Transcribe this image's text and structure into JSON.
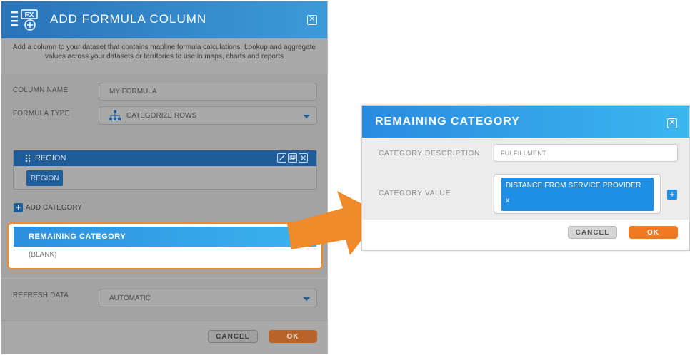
{
  "left_dialog": {
    "title": "ADD FORMULA COLUMN",
    "logo_label": "FX",
    "description": "Add a column to your dataset that contains mapline formula calculations. Lookup and aggregate values across your datasets or territories to use in maps, charts and reports",
    "column_name": {
      "label": "COLUMN NAME",
      "value": "MY FORMULA"
    },
    "formula_type": {
      "label": "FORMULA TYPE",
      "value": "CATEGORIZE ROWS"
    },
    "region": {
      "title": "REGION",
      "chip": "REGION"
    },
    "add_category": "ADD CATEGORY",
    "remaining_category": {
      "title": "REMAINING CATEGORY",
      "value": "(BLANK)"
    },
    "refresh_data": {
      "label": "REFRESH DATA",
      "value": "AUTOMATIC"
    },
    "cancel_label": "CANCEL",
    "ok_label": "OK"
  },
  "right_dialog": {
    "title": "REMAINING CATEGORY",
    "category_description": {
      "label": "CATEGORY DESCRIPTION",
      "value": "FULFILLMENT"
    },
    "category_value": {
      "label": "CATEGORY VALUE",
      "chip_text": "DISTANCE FROM SERVICE PROVIDER",
      "chip_remove": "x"
    },
    "cancel_label": "CANCEL",
    "ok_label": "OK"
  },
  "colors": {
    "accent_blue": "#2b8fe0",
    "highlight_orange": "#f08a2a",
    "ok_orange": "#ee7a24"
  }
}
